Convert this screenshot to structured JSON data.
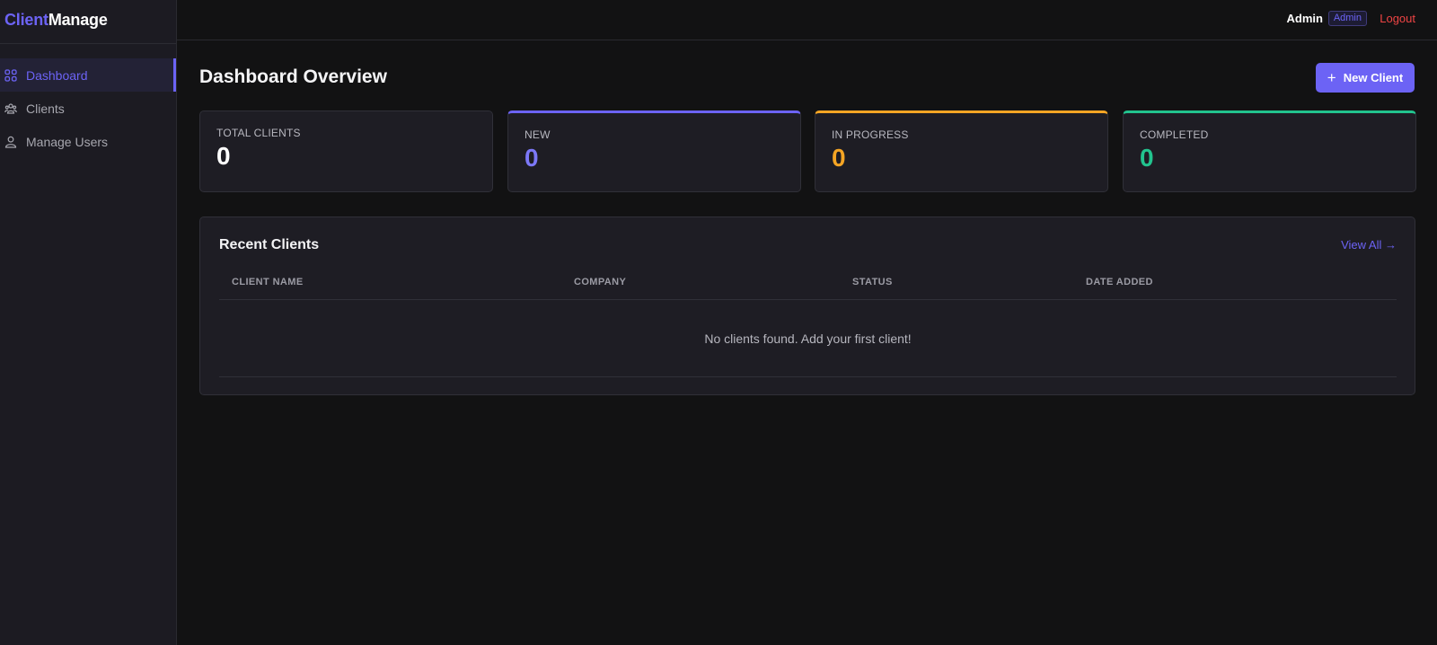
{
  "brand": {
    "part1": "Client",
    "part2": "Manage"
  },
  "sidebar": {
    "items": [
      {
        "label": "Dashboard",
        "icon": "grid-icon",
        "active": true
      },
      {
        "label": "Clients",
        "icon": "users-group-icon",
        "active": false
      },
      {
        "label": "Manage Users",
        "icon": "user-icon",
        "active": false
      }
    ]
  },
  "header": {
    "user_name": "Admin",
    "role_badge": "Admin",
    "logout_label": "Logout"
  },
  "main": {
    "title": "Dashboard Overview",
    "new_button_label": "New Client",
    "stats": [
      {
        "label": "TOTAL CLIENTS",
        "value": "0",
        "color": "#ffffff"
      },
      {
        "label": "NEW",
        "value": "0",
        "color": "#7c78f7"
      },
      {
        "label": "IN PROGRESS",
        "value": "0",
        "color": "#f5a524"
      },
      {
        "label": "COMPLETED",
        "value": "0",
        "color": "#22c38e"
      }
    ],
    "recent": {
      "title": "Recent Clients",
      "view_all_label": "View All →",
      "columns": [
        "CLIENT NAME",
        "COMPANY",
        "STATUS",
        "DATE ADDED"
      ],
      "empty_message": "No clients found. Add your first client!"
    }
  },
  "colors": {
    "accent": "#6c63f5",
    "danger": "#ef4444",
    "warning": "#f5a524",
    "success": "#22c38e",
    "background": "#121213",
    "panel": "#1e1d24"
  }
}
